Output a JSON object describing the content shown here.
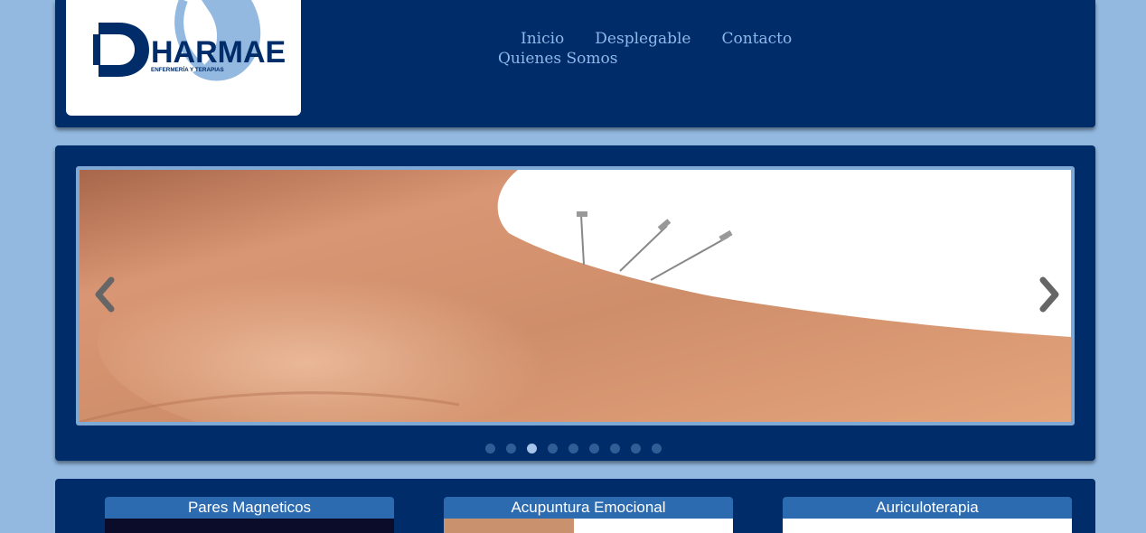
{
  "header": {
    "logo": {
      "brand": "HARMAE",
      "tagline": "ENFERMERÍA Y TERAPIAS"
    },
    "nav": [
      {
        "label": "Inicio"
      },
      {
        "label": "Desplegable"
      },
      {
        "label": "Contacto"
      },
      {
        "label": "Quienes Somos"
      }
    ]
  },
  "slider": {
    "slide_count": 9,
    "active_index": 2,
    "prev_icon": "chevron-left-icon",
    "next_icon": "chevron-right-icon"
  },
  "cards": [
    {
      "title": "Pares Magneticos"
    },
    {
      "title": "Acupuntura Emocional"
    },
    {
      "title": "Auriculoterapia"
    }
  ],
  "colors": {
    "page_background": "#93b9e0",
    "panel": "#002c69",
    "nav_text": "#8fb8ea",
    "card_header": "#2d6bb0"
  }
}
